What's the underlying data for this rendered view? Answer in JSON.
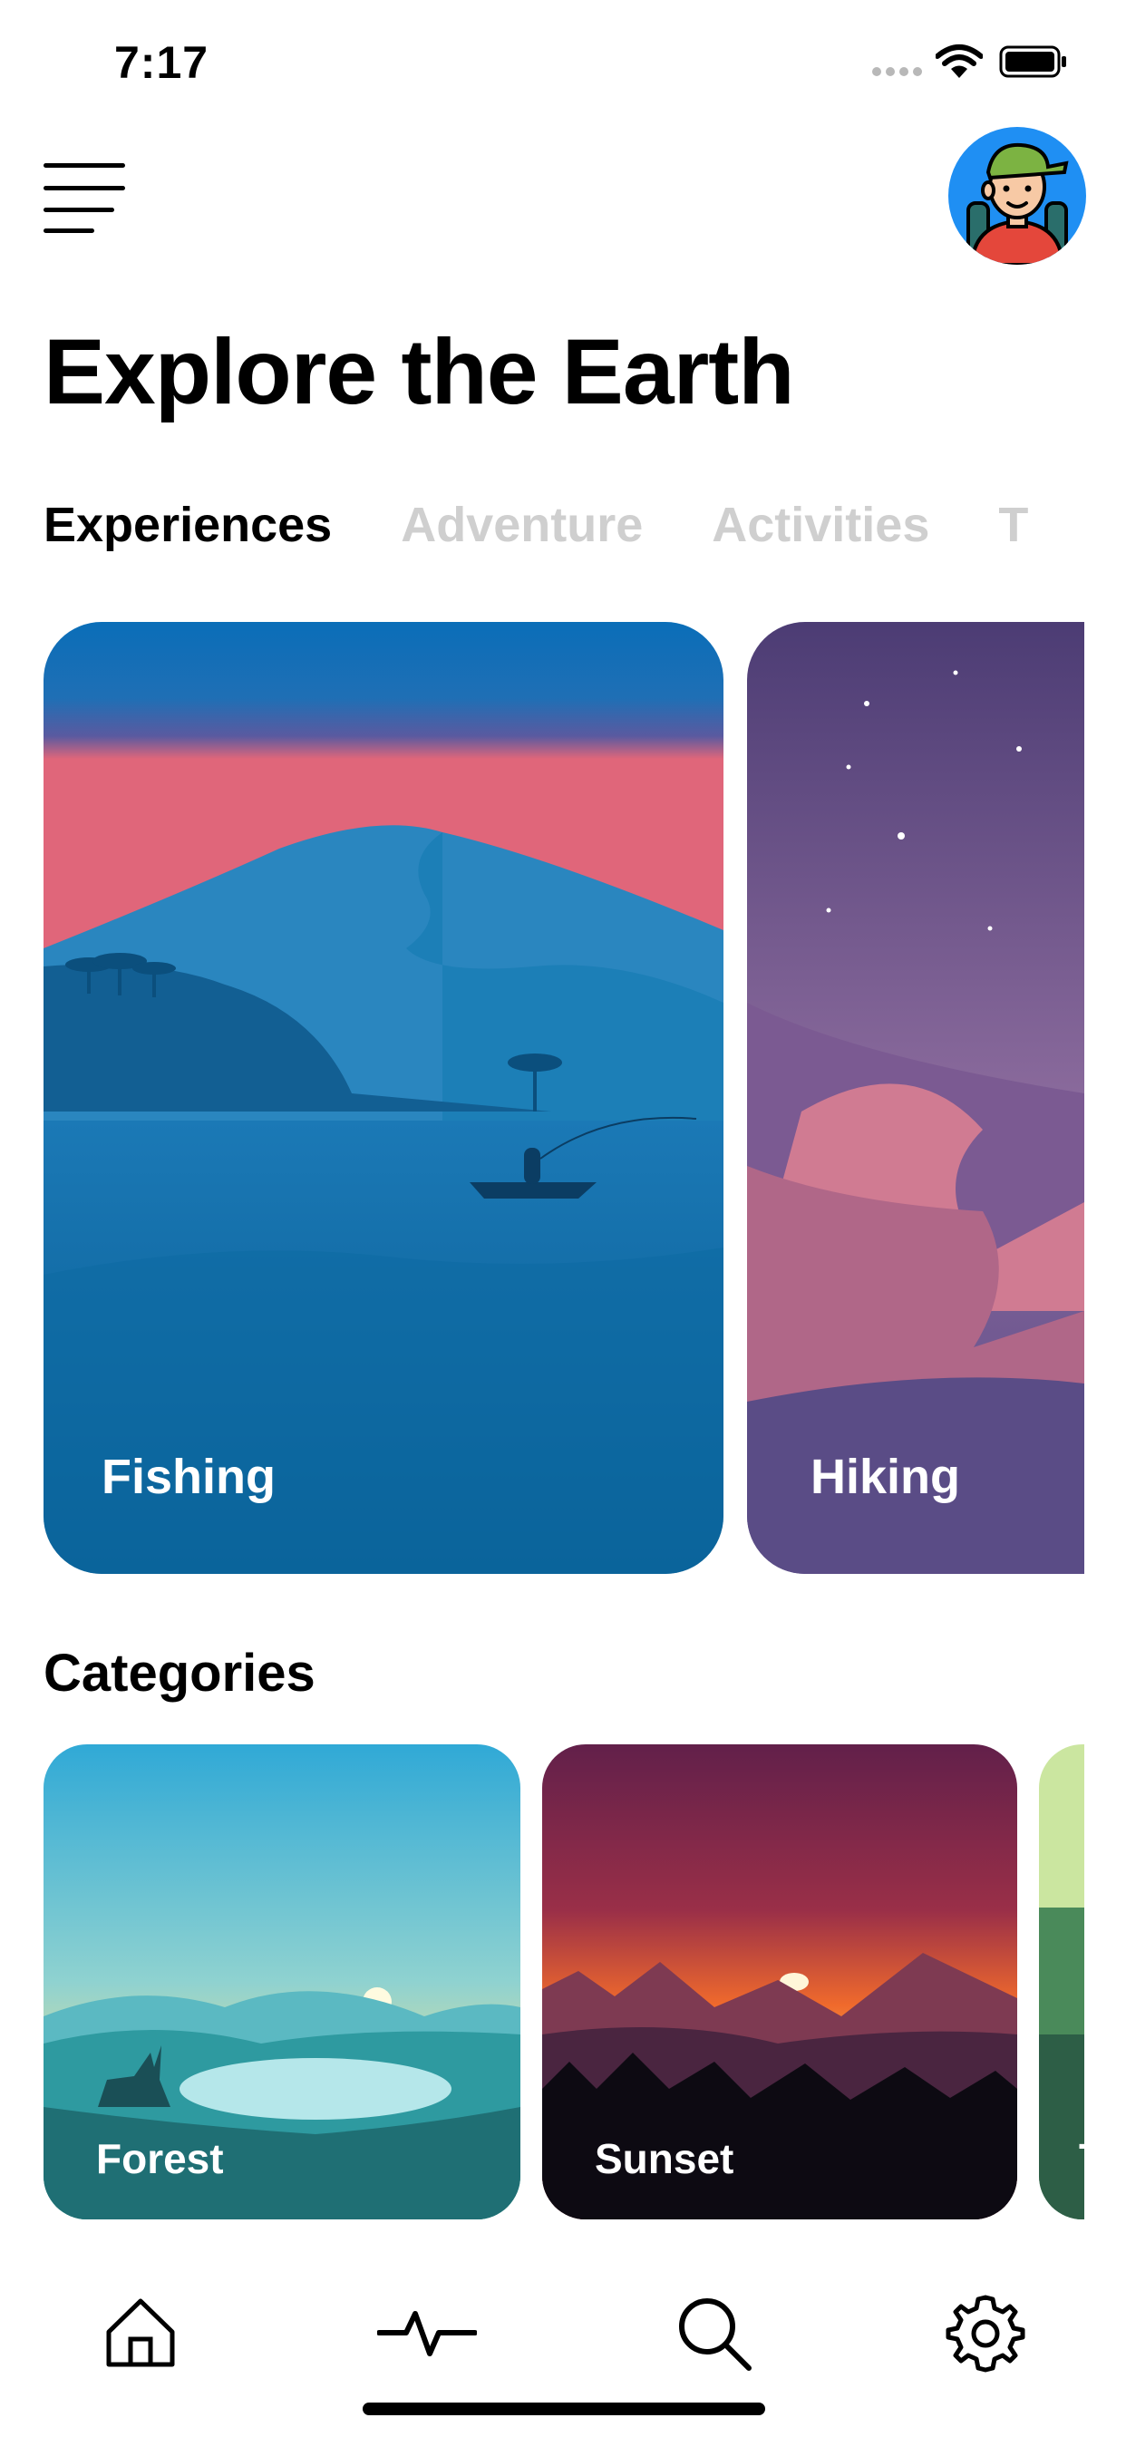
{
  "status_bar": {
    "time": "7:17"
  },
  "header": {
    "title": "Explore the Earth"
  },
  "tabs": [
    {
      "label": "Experiences",
      "active": true
    },
    {
      "label": "Adventure",
      "active": false
    },
    {
      "label": "Activities",
      "active": false
    },
    {
      "label": "T",
      "active": false
    }
  ],
  "experiences": [
    {
      "label": "Fishing"
    },
    {
      "label": "Hiking"
    }
  ],
  "categories": {
    "heading": "Categories",
    "items": [
      {
        "label": "Forest"
      },
      {
        "label": "Sunset"
      },
      {
        "label": "T"
      }
    ]
  },
  "nav": {
    "items": [
      {
        "icon": "home-icon"
      },
      {
        "icon": "activity-icon"
      },
      {
        "icon": "search-icon"
      },
      {
        "icon": "settings-icon"
      }
    ]
  },
  "colors": {
    "active_tab": "#000000",
    "inactive_tab": "#cfcfcf",
    "avatar_bg": "#1f8ff3"
  }
}
